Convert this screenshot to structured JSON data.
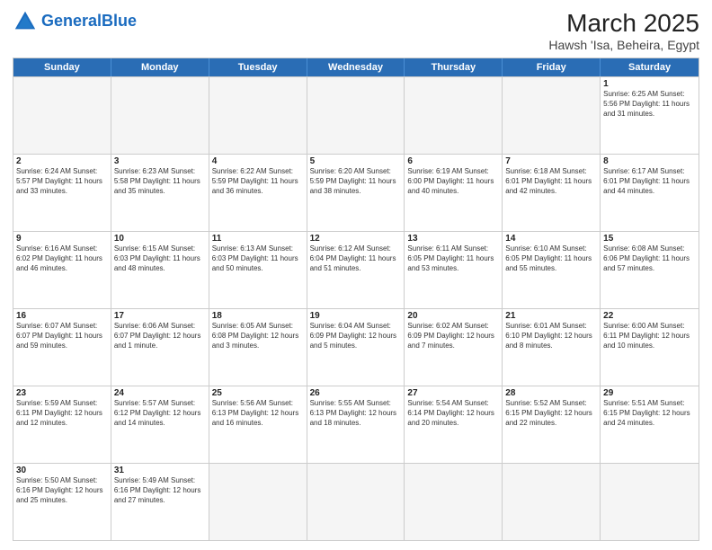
{
  "header": {
    "logo_general": "General",
    "logo_blue": "Blue",
    "title": "March 2025",
    "subtitle": "Hawsh 'Isa, Beheira, Egypt"
  },
  "weekdays": [
    "Sunday",
    "Monday",
    "Tuesday",
    "Wednesday",
    "Thursday",
    "Friday",
    "Saturday"
  ],
  "rows": [
    [
      {
        "day": "",
        "info": ""
      },
      {
        "day": "",
        "info": ""
      },
      {
        "day": "",
        "info": ""
      },
      {
        "day": "",
        "info": ""
      },
      {
        "day": "",
        "info": ""
      },
      {
        "day": "",
        "info": ""
      },
      {
        "day": "1",
        "info": "Sunrise: 6:25 AM\nSunset: 5:56 PM\nDaylight: 11 hours and 31 minutes."
      }
    ],
    [
      {
        "day": "2",
        "info": "Sunrise: 6:24 AM\nSunset: 5:57 PM\nDaylight: 11 hours and 33 minutes."
      },
      {
        "day": "3",
        "info": "Sunrise: 6:23 AM\nSunset: 5:58 PM\nDaylight: 11 hours and 35 minutes."
      },
      {
        "day": "4",
        "info": "Sunrise: 6:22 AM\nSunset: 5:59 PM\nDaylight: 11 hours and 36 minutes."
      },
      {
        "day": "5",
        "info": "Sunrise: 6:20 AM\nSunset: 5:59 PM\nDaylight: 11 hours and 38 minutes."
      },
      {
        "day": "6",
        "info": "Sunrise: 6:19 AM\nSunset: 6:00 PM\nDaylight: 11 hours and 40 minutes."
      },
      {
        "day": "7",
        "info": "Sunrise: 6:18 AM\nSunset: 6:01 PM\nDaylight: 11 hours and 42 minutes."
      },
      {
        "day": "8",
        "info": "Sunrise: 6:17 AM\nSunset: 6:01 PM\nDaylight: 11 hours and 44 minutes."
      }
    ],
    [
      {
        "day": "9",
        "info": "Sunrise: 6:16 AM\nSunset: 6:02 PM\nDaylight: 11 hours and 46 minutes."
      },
      {
        "day": "10",
        "info": "Sunrise: 6:15 AM\nSunset: 6:03 PM\nDaylight: 11 hours and 48 minutes."
      },
      {
        "day": "11",
        "info": "Sunrise: 6:13 AM\nSunset: 6:03 PM\nDaylight: 11 hours and 50 minutes."
      },
      {
        "day": "12",
        "info": "Sunrise: 6:12 AM\nSunset: 6:04 PM\nDaylight: 11 hours and 51 minutes."
      },
      {
        "day": "13",
        "info": "Sunrise: 6:11 AM\nSunset: 6:05 PM\nDaylight: 11 hours and 53 minutes."
      },
      {
        "day": "14",
        "info": "Sunrise: 6:10 AM\nSunset: 6:05 PM\nDaylight: 11 hours and 55 minutes."
      },
      {
        "day": "15",
        "info": "Sunrise: 6:08 AM\nSunset: 6:06 PM\nDaylight: 11 hours and 57 minutes."
      }
    ],
    [
      {
        "day": "16",
        "info": "Sunrise: 6:07 AM\nSunset: 6:07 PM\nDaylight: 11 hours and 59 minutes."
      },
      {
        "day": "17",
        "info": "Sunrise: 6:06 AM\nSunset: 6:07 PM\nDaylight: 12 hours and 1 minute."
      },
      {
        "day": "18",
        "info": "Sunrise: 6:05 AM\nSunset: 6:08 PM\nDaylight: 12 hours and 3 minutes."
      },
      {
        "day": "19",
        "info": "Sunrise: 6:04 AM\nSunset: 6:09 PM\nDaylight: 12 hours and 5 minutes."
      },
      {
        "day": "20",
        "info": "Sunrise: 6:02 AM\nSunset: 6:09 PM\nDaylight: 12 hours and 7 minutes."
      },
      {
        "day": "21",
        "info": "Sunrise: 6:01 AM\nSunset: 6:10 PM\nDaylight: 12 hours and 8 minutes."
      },
      {
        "day": "22",
        "info": "Sunrise: 6:00 AM\nSunset: 6:11 PM\nDaylight: 12 hours and 10 minutes."
      }
    ],
    [
      {
        "day": "23",
        "info": "Sunrise: 5:59 AM\nSunset: 6:11 PM\nDaylight: 12 hours and 12 minutes."
      },
      {
        "day": "24",
        "info": "Sunrise: 5:57 AM\nSunset: 6:12 PM\nDaylight: 12 hours and 14 minutes."
      },
      {
        "day": "25",
        "info": "Sunrise: 5:56 AM\nSunset: 6:13 PM\nDaylight: 12 hours and 16 minutes."
      },
      {
        "day": "26",
        "info": "Sunrise: 5:55 AM\nSunset: 6:13 PM\nDaylight: 12 hours and 18 minutes."
      },
      {
        "day": "27",
        "info": "Sunrise: 5:54 AM\nSunset: 6:14 PM\nDaylight: 12 hours and 20 minutes."
      },
      {
        "day": "28",
        "info": "Sunrise: 5:52 AM\nSunset: 6:15 PM\nDaylight: 12 hours and 22 minutes."
      },
      {
        "day": "29",
        "info": "Sunrise: 5:51 AM\nSunset: 6:15 PM\nDaylight: 12 hours and 24 minutes."
      }
    ],
    [
      {
        "day": "30",
        "info": "Sunrise: 5:50 AM\nSunset: 6:16 PM\nDaylight: 12 hours and 25 minutes."
      },
      {
        "day": "31",
        "info": "Sunrise: 5:49 AM\nSunset: 6:16 PM\nDaylight: 12 hours and 27 minutes."
      },
      {
        "day": "",
        "info": ""
      },
      {
        "day": "",
        "info": ""
      },
      {
        "day": "",
        "info": ""
      },
      {
        "day": "",
        "info": ""
      },
      {
        "day": "",
        "info": ""
      }
    ]
  ]
}
